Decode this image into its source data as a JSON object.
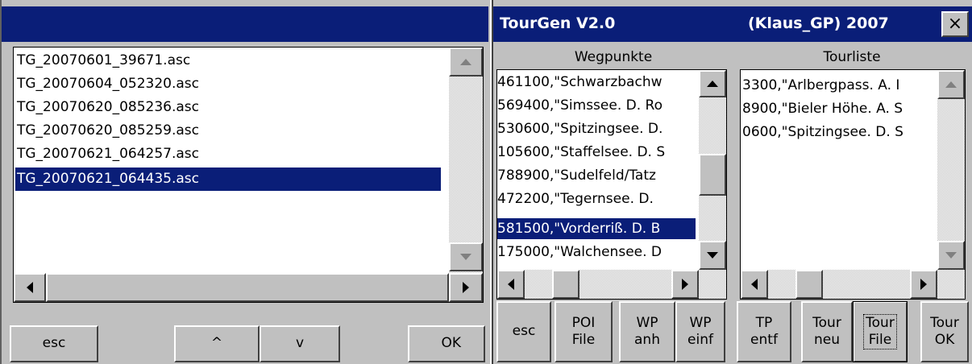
{
  "left_dialog": {
    "title": "",
    "files": [
      "TG_20070601_39671.asc",
      "TG_20070604_052320.asc",
      "TG_20070620_085236.asc",
      "TG_20070620_085259.asc",
      "TG_20070621_064257.asc",
      "TG_20070621_064435.asc"
    ],
    "selected_index": 5,
    "buttons": {
      "esc": "esc",
      "up": "^",
      "down": "v",
      "ok": "OK"
    }
  },
  "tourgen": {
    "title_app": "TourGen V2.0",
    "title_author": "(Klaus_GP) 2007",
    "close_label": "×",
    "waypoints_header": "Wegpunkte",
    "tourlist_header": "Tourliste",
    "waypoints": [
      "461100,\"Schwarzbachw",
      "569400,\"Simssee. D. Ro",
      "530600,\"Spitzingsee. D.",
      "105600,\"Staffelsee. D. S",
      "788900,\"Sudelfeld/Tatz",
      "472200,\"Tegernsee. D.",
      "581500,\"Vorderriß. D. B",
      "175000,\"Walchensee. D"
    ],
    "waypoints_selected_index": 6,
    "tourlist": [
      "3300,\"Arlbergpass. A. I",
      "8900,\"Bieler Höhe. A. S",
      "0600,\"Spitzingsee. D. S"
    ],
    "buttons": {
      "esc": "esc",
      "poi_line1": "POI",
      "poi_line2": "File",
      "wp_anh_line1": "WP",
      "wp_anh_line2": "anh",
      "wp_einf_line1": "WP",
      "wp_einf_line2": "einf",
      "tp_entf_line1": "TP",
      "tp_entf_line2": "entf",
      "tour_neu_line1": "Tour",
      "tour_neu_line2": "neu",
      "tour_file_line1": "Tour",
      "tour_file_line2": "File",
      "tour_ok_line1": "Tour",
      "tour_ok_line2": "OK"
    }
  },
  "colors": {
    "titlebar": "#0a1e78",
    "face": "#c0c0c0",
    "selection": "#0a1e78"
  }
}
